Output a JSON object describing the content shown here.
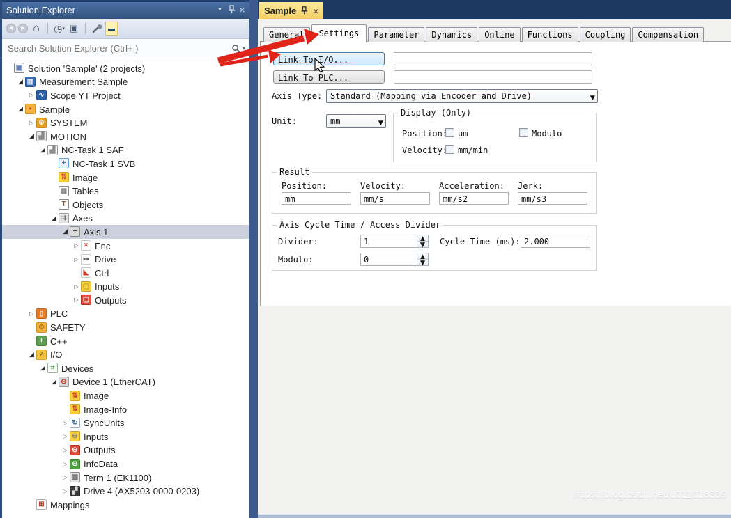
{
  "colors": {
    "annotation_red": "#e0241a",
    "active_doc_tab_top": "#fbe89a",
    "active_doc_tab_bottom": "#f2cf62",
    "tree_selection": "#ccd2dd",
    "titlebar_blue": "#33547f",
    "divider_blue": "#3d5b8e",
    "link_button_hover": "#cfe7fa"
  },
  "watermark": "https://blog.csdn.net/u011618339",
  "solution_explorer": {
    "title": "Solution Explorer",
    "titlebar_icons": [
      "window-position-menu-icon",
      "pin-icon",
      "close-icon"
    ],
    "toolbar_icons": [
      "back",
      "forward",
      "home",
      "sync-with-active-document",
      "show-all-files",
      "properties-wrench",
      "collapse-all"
    ],
    "search_placeholder": "Search Solution Explorer (Ctrl+;)",
    "tree": [
      {
        "label": "Solution 'Sample' (2 projects)",
        "depth": 0,
        "arrow": "n",
        "icon": "solution",
        "bg": "#f7f7f7",
        "fg": "#5c7cba",
        "bd": "#8a8a8a",
        "glyph": "▣"
      },
      {
        "label": "Measurement Sample",
        "depth": 1,
        "arrow": "e",
        "icon": "measurement-project",
        "bg": "#3a6bb0",
        "fg": "#ffffff",
        "bd": "#2d5590",
        "glyph": "▥"
      },
      {
        "label": "Scope YT Project",
        "depth": 2,
        "arrow": "c",
        "icon": "scope-project",
        "bg": "#2e62a8",
        "fg": "#ffffff",
        "bd": "#24508c",
        "glyph": "∿"
      },
      {
        "label": "Sample",
        "depth": 1,
        "arrow": "e",
        "icon": "twincat-project",
        "bg": "#f2b23c",
        "fg": "#c0392b",
        "bd": "#cf9427",
        "glyph": "▪"
      },
      {
        "label": "SYSTEM",
        "depth": 2,
        "arrow": "c",
        "icon": "system",
        "bg": "#e8a020",
        "fg": "#ffffff",
        "bd": "#c5871a",
        "glyph": "⚙"
      },
      {
        "label": "MOTION",
        "depth": 2,
        "arrow": "e",
        "icon": "motion",
        "bg": "#e9e9e9",
        "fg": "#8a8a8a",
        "bd": "#9a9a9a",
        "glyph": "▟"
      },
      {
        "label": "NC-Task 1 SAF",
        "depth": 3,
        "arrow": "e",
        "icon": "nc-task-saf",
        "bg": "#ffffff",
        "fg": "#8a8a8a",
        "bd": "#9a9a9a",
        "glyph": "▟"
      },
      {
        "label": "NC-Task 1 SVB",
        "depth": 4,
        "arrow": "n",
        "icon": "nc-task-svb",
        "bg": "#e8f1fb",
        "fg": "#2e74b5",
        "bd": "#5b9bd5",
        "glyph": "+"
      },
      {
        "label": "Image",
        "depth": 4,
        "arrow": "n",
        "icon": "process-image",
        "bg": "#f5ce3e",
        "fg": "#d33c2a",
        "bd": "#cfa827",
        "glyph": "⇅"
      },
      {
        "label": "Tables",
        "depth": 4,
        "arrow": "n",
        "icon": "tables",
        "bg": "#ffffff",
        "fg": "#8a8a8a",
        "bd": "#8a8a8a",
        "glyph": "▦"
      },
      {
        "label": "Objects",
        "depth": 4,
        "arrow": "n",
        "icon": "objects",
        "bg": "#ffffff",
        "fg": "#a0522d",
        "bd": "#8a8a8a",
        "glyph": "T"
      },
      {
        "label": "Axes",
        "depth": 4,
        "arrow": "e",
        "icon": "axes",
        "bg": "#e3e3e3",
        "fg": "#555555",
        "bd": "#9a9a9a",
        "glyph": "⇉"
      },
      {
        "label": "Axis 1",
        "depth": 5,
        "arrow": "e",
        "icon": "axis",
        "bg": "#d9d9d9",
        "fg": "#444444",
        "bd": "#8a8a8a",
        "glyph": "+",
        "selected": true
      },
      {
        "label": "Enc",
        "depth": 6,
        "arrow": "c",
        "icon": "encoder",
        "bg": "#ffffff",
        "fg": "#d33c2a",
        "bd": "#c8c8c8",
        "glyph": "×"
      },
      {
        "label": "Drive",
        "depth": 6,
        "arrow": "c",
        "icon": "drive",
        "bg": "#ffffff",
        "fg": "#555555",
        "bd": "#c8c8c8",
        "glyph": "↦"
      },
      {
        "label": "Ctrl",
        "depth": 6,
        "arrow": "n",
        "icon": "ctrl",
        "bg": "#ffffff",
        "fg": "#d33c2a",
        "bd": "#c8c8c8",
        "glyph": "◣"
      },
      {
        "label": "Inputs",
        "depth": 6,
        "arrow": "c",
        "icon": "inputs",
        "bg": "#f7d23e",
        "fg": "#bd9a1f",
        "bd": "#c9a227",
        "glyph": "▢"
      },
      {
        "label": "Outputs",
        "depth": 6,
        "arrow": "c",
        "icon": "outputs",
        "bg": "#e04a38",
        "fg": "#ffffff",
        "bd": "#a83226",
        "glyph": "▢"
      },
      {
        "label": "PLC",
        "depth": 2,
        "arrow": "c",
        "icon": "plc",
        "bg": "#e87f28",
        "fg": "#ffffff",
        "bd": "#c2641c",
        "glyph": "▯"
      },
      {
        "label": "SAFETY",
        "depth": 2,
        "arrow": "n",
        "icon": "safety",
        "bg": "#f2b23c",
        "fg": "#b07515",
        "bd": "#cf9427",
        "glyph": "⚙"
      },
      {
        "label": "C++",
        "depth": 2,
        "arrow": "n",
        "icon": "cpp",
        "bg": "#5f9e52",
        "fg": "#ffffff",
        "bd": "#4a8040",
        "glyph": "+"
      },
      {
        "label": "I/O",
        "depth": 2,
        "arrow": "e",
        "icon": "io",
        "bg": "#f2c23c",
        "fg": "#7a5d12",
        "bd": "#cf9f27",
        "glyph": "Z"
      },
      {
        "label": "Devices",
        "depth": 3,
        "arrow": "e",
        "icon": "devices",
        "bg": "#ffffff",
        "fg": "#4a9a4a",
        "bd": "#9ab09a",
        "glyph": "⌗"
      },
      {
        "label": "Device 1 (EtherCAT)",
        "depth": 4,
        "arrow": "e",
        "icon": "device-ethercat",
        "bg": "#d8d8d8",
        "fg": "#d33c2a",
        "bd": "#9a9a9a",
        "glyph": "⊖"
      },
      {
        "label": "Image",
        "depth": 5,
        "arrow": "n",
        "icon": "process-image",
        "bg": "#f5ce3e",
        "fg": "#d33c2a",
        "bd": "#cfa827",
        "glyph": "⇅"
      },
      {
        "label": "Image-Info",
        "depth": 5,
        "arrow": "n",
        "icon": "process-image-info",
        "bg": "#f5ce3e",
        "fg": "#d33c2a",
        "bd": "#cfa827",
        "glyph": "⇅"
      },
      {
        "label": "SyncUnits",
        "depth": 5,
        "arrow": "c",
        "icon": "sync-units",
        "bg": "#ffffff",
        "fg": "#2e62a8",
        "bd": "#9ab0c8",
        "glyph": "↻"
      },
      {
        "label": "Inputs",
        "depth": 5,
        "arrow": "c",
        "icon": "device-inputs",
        "bg": "#f7d23e",
        "fg": "#8a8a8a",
        "bd": "#c9a227",
        "glyph": "⊖"
      },
      {
        "label": "Outputs",
        "depth": 5,
        "arrow": "c",
        "icon": "device-outputs",
        "bg": "#e04a38",
        "fg": "#ffffff",
        "bd": "#a83226",
        "glyph": "⊖"
      },
      {
        "label": "InfoData",
        "depth": 5,
        "arrow": "c",
        "icon": "info-data",
        "bg": "#4f9e3f",
        "fg": "#ffffff",
        "bd": "#3e7e32",
        "glyph": "⊖"
      },
      {
        "label": "Term 1 (EK1100)",
        "depth": 5,
        "arrow": "c",
        "icon": "terminal",
        "bg": "#e2e2e2",
        "fg": "#666666",
        "bd": "#8a8a8a",
        "glyph": "▥"
      },
      {
        "label": "Drive 4 (AX5203-0000-0203)",
        "depth": 5,
        "arrow": "c",
        "icon": "drive-ax5203",
        "bg": "#3a3a3a",
        "fg": "#dddddd",
        "bd": "#222222",
        "glyph": "▞"
      },
      {
        "label": "Mappings",
        "depth": 2,
        "arrow": "n",
        "icon": "mappings",
        "bg": "#ffffff",
        "fg": "#c04030",
        "bd": "#b0b0b0",
        "glyph": "⊞"
      }
    ]
  },
  "document": {
    "tab_title": "Sample",
    "tab_icons": [
      "pin-icon",
      "close-icon"
    ],
    "tabs": [
      "General",
      "Settings",
      "Parameter",
      "Dynamics",
      "Online",
      "Functions",
      "Coupling",
      "Compensation"
    ],
    "active_tab": "Settings",
    "form": {
      "link_io_button": "Link To I/O...",
      "link_io_value": "",
      "link_plc_button": "Link To PLC...",
      "link_plc_value": "",
      "axis_type_label": "Axis Type:",
      "axis_type_value": "Standard (Mapping via Encoder and Drive)",
      "unit_label": "Unit:",
      "unit_value": "mm",
      "display_group": {
        "title": "Display (Only)",
        "position_label": "Position:",
        "position_unit": "μm",
        "position_checked": false,
        "modulo_label": "Modulo",
        "modulo_checked": false,
        "velocity_label": "Velocity:",
        "velocity_unit": "mm/min",
        "velocity_checked": false
      },
      "result_group": {
        "title": "Result",
        "columns": [
          {
            "label": "Position:",
            "value": "mm"
          },
          {
            "label": "Velocity:",
            "value": "mm/s"
          },
          {
            "label": "Acceleration:",
            "value": "mm/s2"
          },
          {
            "label": "Jerk:",
            "value": "mm/s3"
          }
        ]
      },
      "cycle_group": {
        "title": "Axis Cycle Time / Access Divider",
        "divider_label": "Divider:",
        "divider_value": "1",
        "cycle_time_label": "Cycle Time (ms):",
        "cycle_time_value": "2.000",
        "modulo_label": "Modulo:",
        "modulo_value": "0"
      }
    }
  }
}
